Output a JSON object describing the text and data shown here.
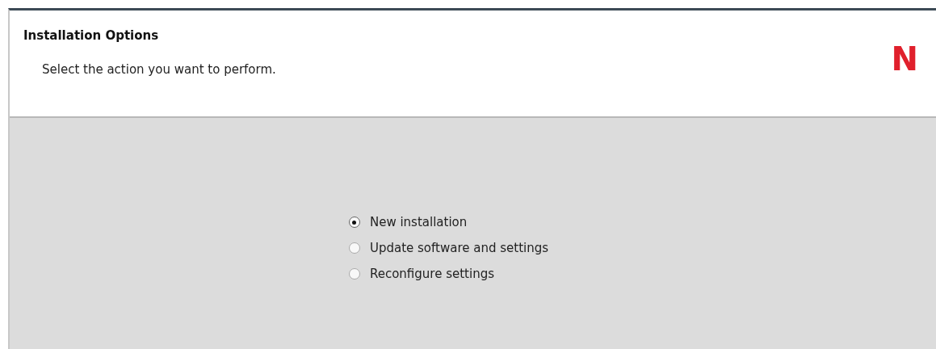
{
  "header": {
    "title": "Installation Options",
    "subtitle": "Select the action you want to perform.",
    "logo": "N"
  },
  "options": [
    {
      "label": "New installation",
      "selected": true
    },
    {
      "label": "Update software and settings",
      "selected": false
    },
    {
      "label": "Reconfigure settings",
      "selected": false
    }
  ]
}
